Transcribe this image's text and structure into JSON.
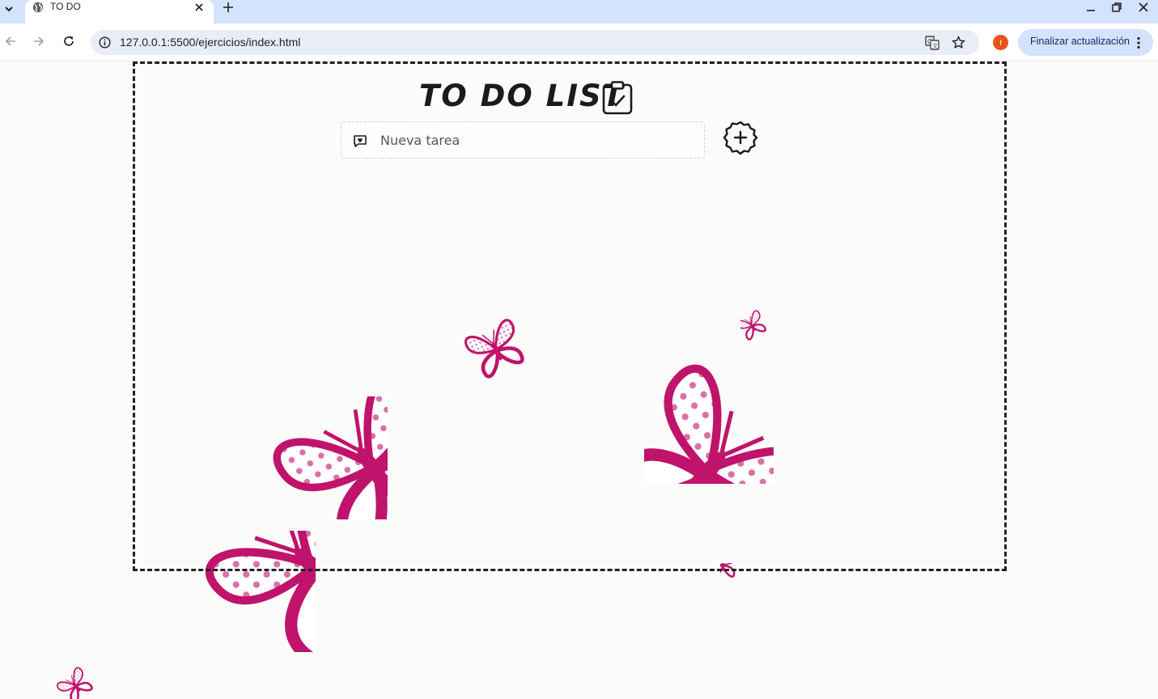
{
  "browser": {
    "tab_title": "TO DO",
    "url": "127.0.0.1:5500/ejercicios/index.html",
    "profile_initial": "f",
    "update_button_label": "Finalizar actualización",
    "accent_color": "#d3e3fd",
    "profile_color": "#e8541d"
  },
  "app": {
    "title": "TO DO LIST",
    "task_input_placeholder": "Nueva tarea",
    "butterfly_color": "#c0136b"
  },
  "icons": {
    "tab_favicon": "globe-icon",
    "title_icon": "clipboard-check-icon",
    "input_icon": "message-heart-icon",
    "add_button": "circle-plus-icon"
  }
}
